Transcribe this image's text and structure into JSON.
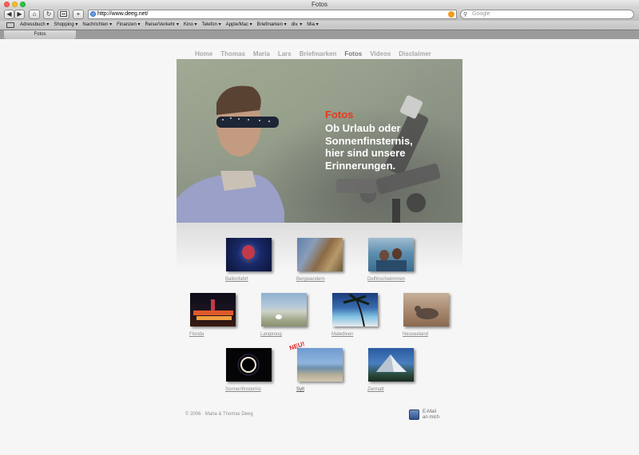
{
  "window": {
    "title": "Fotos"
  },
  "toolbar": {
    "url": "http://www.deeg.net/",
    "search_placeholder": "Google",
    "back_glyph": "◀",
    "forward_glyph": "▶",
    "home_glyph": "⌂",
    "reload_glyph": "↻",
    "add_glyph": "+"
  },
  "bookmarks": [
    "Adressbuch ▾",
    "Shopping ▾",
    "Nachrichten ▾",
    "Finanzen ▾",
    "Reise/Verkehr ▾",
    "Kino ▾",
    "Telefon ▾",
    "Apple/Mac ▾",
    "Briefmarken ▾",
    "div. ▾",
    "Mia ▾"
  ],
  "tab": {
    "label": "Fotos"
  },
  "nav": {
    "home": "Home",
    "thomas": "Thomas",
    "maria": "Maria",
    "lars": "Lars",
    "briefmarken": "Briefmarken",
    "fotos": "Fotos",
    "videos": "Videos",
    "disclaimer": "Disclaimer"
  },
  "hero": {
    "title": "Fotos",
    "text": "Ob Urlaub oder\nSonnenfinsternis,\nhier  sind unsere\nErinnerungen."
  },
  "gallery": {
    "ballonfahrt": "Ballonfahrt",
    "bergwandern": "Bergwandern",
    "delfinschwimmen": "Delfinschwimmen",
    "florida": "Florida",
    "langeoog": "Langeoog",
    "malediven": "Malediven",
    "neuseeland": "Neuseeland",
    "sonnenfinsternis": "Sonnenfinsternis",
    "sylt": "Sylt",
    "zermatt": "Zermatt",
    "neu_badge": "NEU!"
  },
  "footer": {
    "copyright": "© 2006 · Maria & Thomas Deeg",
    "mail_line1": "E-Mail",
    "mail_line2": "an mich"
  },
  "colors": {
    "accent_red": "#e53a1c",
    "nav_gray": "#a8a8a8"
  }
}
